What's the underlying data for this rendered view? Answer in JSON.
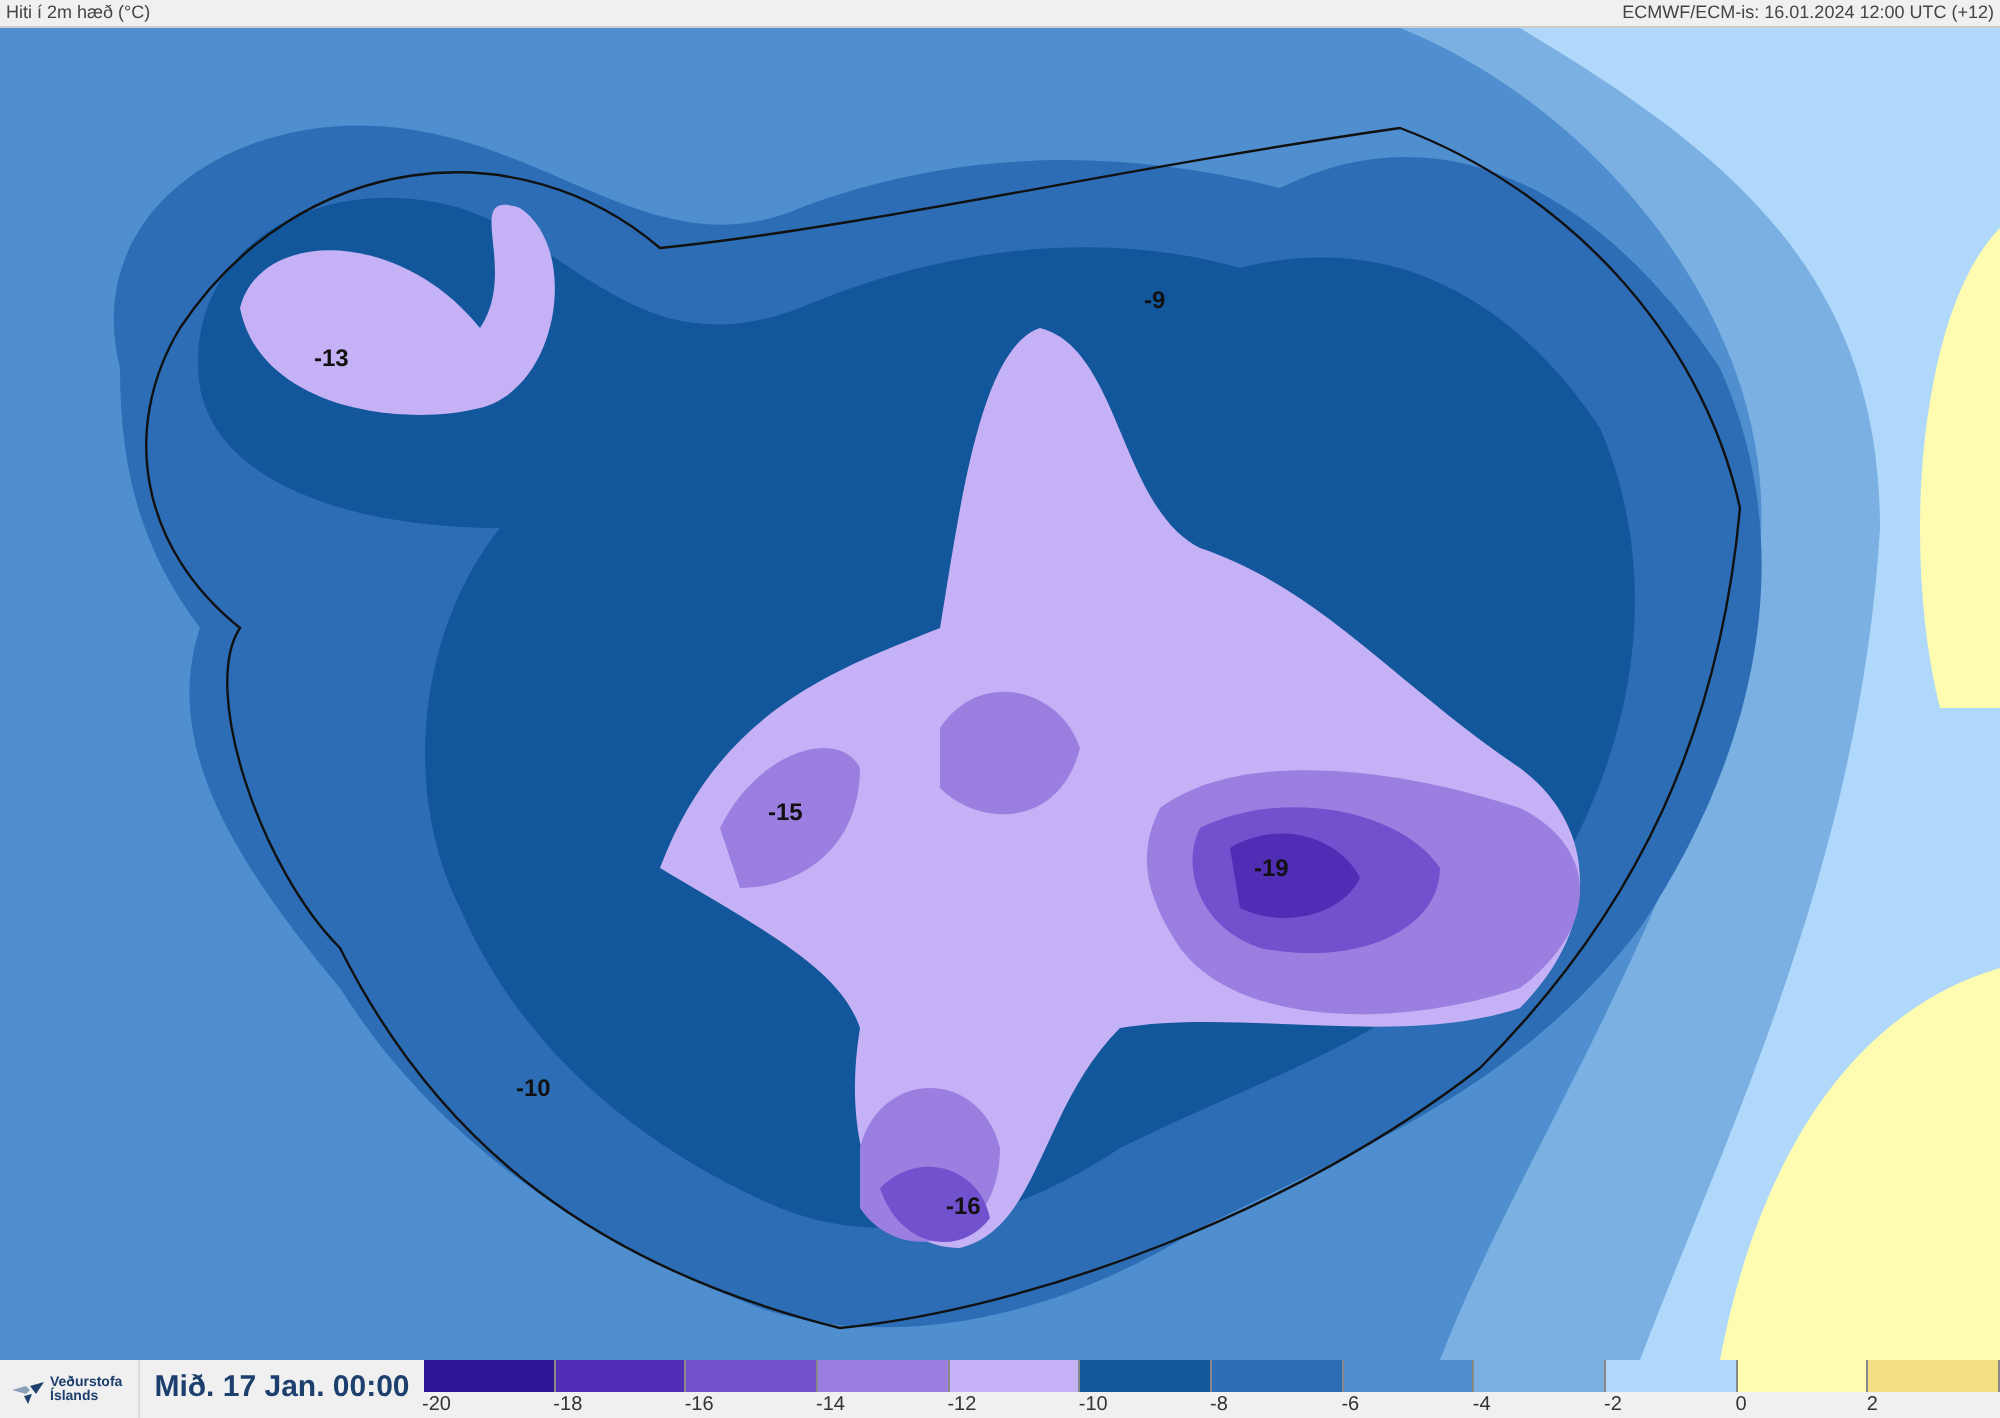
{
  "header": {
    "title": "Hiti í 2m hæð (°C)",
    "model_info": "ECMWF/ECM-is: 16.01.2024 12:00 UTC (+12)"
  },
  "map_labels": [
    "-13",
    "-9",
    "-15",
    "-19",
    "-10",
    "-16"
  ],
  "footer": {
    "logo_text": [
      "Veðurstofa",
      "Íslands"
    ],
    "valid_time": "Mið. 17 Jan. 00:00"
  },
  "legend": [
    {
      "color": "#2e1596",
      "label": "-20"
    },
    {
      "color": "#4f2db5",
      "label": "-18"
    },
    {
      "color": "#7251cf",
      "label": "-16"
    },
    {
      "color": "#9a7fe0",
      "label": "-14"
    },
    {
      "color": "#c5b1f5",
      "label": "-12"
    },
    {
      "color": "#12569b",
      "label": "-10"
    },
    {
      "color": "#2c6db5",
      "label": "-8"
    },
    {
      "color": "#4f8fd0",
      "label": "-6"
    },
    {
      "color": "#7bb0e2",
      "label": "-4"
    },
    {
      "color": "#b0d8fb",
      "label": "-2"
    },
    {
      "color": "#fdfcb0",
      "label": "0"
    },
    {
      "color": "#f2e083",
      "label": "2"
    }
  ]
}
